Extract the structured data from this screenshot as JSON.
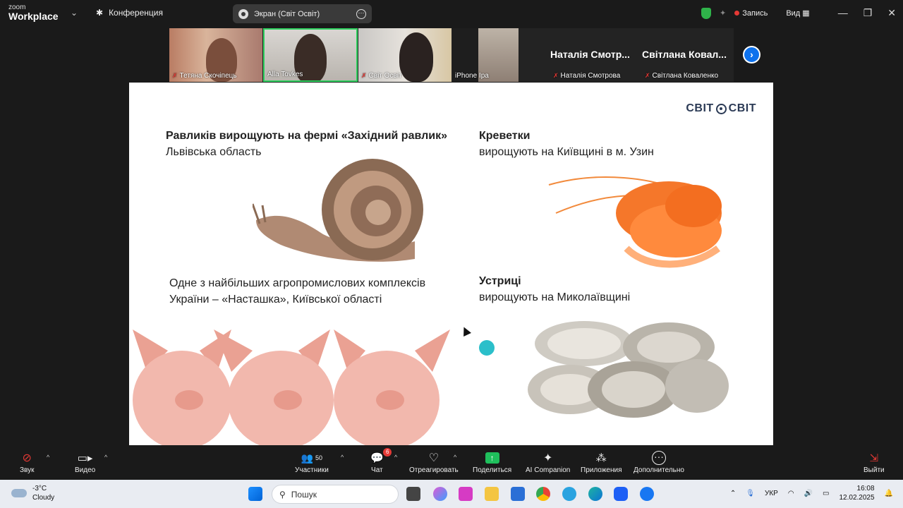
{
  "titlebar": {
    "logo_line1": "zoom",
    "logo_line2": "Workplace",
    "conference_label": "Конференция",
    "screen_label": "Экран (Світ Освіт)",
    "record_label": "Запись",
    "view_label": "Вид"
  },
  "participants": [
    {
      "name": "Тетяна Скочіпець",
      "muted": true
    },
    {
      "name": "Alla Tovkes",
      "muted": false
    },
    {
      "name": "Світ Освіт",
      "muted": true
    },
    {
      "name": "iPhone Ipa",
      "muted": false
    },
    {
      "name": "Наталія Смотрова",
      "display_name": "Наталія Смотр...",
      "muted": true
    },
    {
      "name": "Світлана Коваленко",
      "display_name": "Світлана Ковал...",
      "muted": true
    }
  ],
  "slide": {
    "brand": [
      "СВІТ",
      "СВІТ"
    ],
    "snails_title": "Равликів вирощують на фермі «Західний равлик»",
    "snails_sub": "Львівська область",
    "shrimp_title": "Креветки",
    "shrimp_sub": "вирощують на Київщині в м. Узин",
    "pigs_line1": "Одне з найбільших агропромислових комплексів",
    "pigs_line2": "України – «Насташка», Київської області",
    "oysters_title": "Устриці",
    "oysters_sub": "вирощують на Миколаївщині"
  },
  "toolbar": {
    "audio": "Звук",
    "video": "Видео",
    "participants": "Участники",
    "participants_count": "50",
    "chat": "Чат",
    "chat_badge": "6",
    "react": "Отреагировать",
    "share": "Поделиться",
    "ai": "AI Companion",
    "apps": "Приложения",
    "more": "Дополнительно",
    "leave": "Выйти"
  },
  "taskbar": {
    "temp": "-3°C",
    "weather": "Cloudy",
    "search_placeholder": "Пошук",
    "lang": "УКР",
    "time": "16:08",
    "date": "12.02.2025"
  }
}
